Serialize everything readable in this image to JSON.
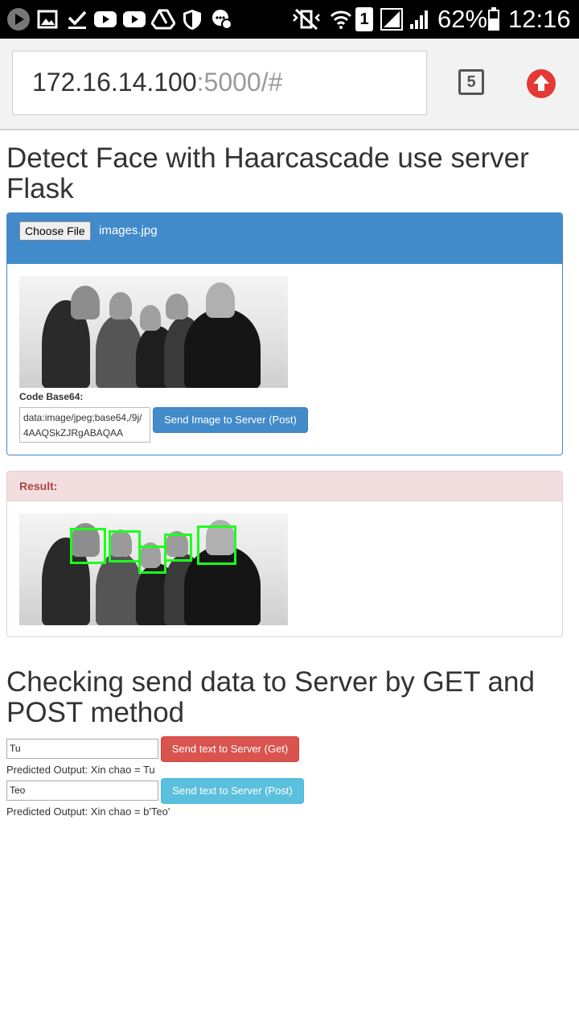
{
  "statusbar": {
    "battery": "62%",
    "time": "12:16",
    "sim_slot": "1"
  },
  "browser": {
    "url_host": "172.16.14.100",
    "url_rest": ":5000/#",
    "tab_count": "5",
    "accent_color": "#e53935"
  },
  "page": {
    "title": "Detect Face with Haarcascade use server Flask",
    "upload_panel": {
      "choose_file_label": "Choose File",
      "file_name": "images.jpg",
      "code_label": "Code Base64:",
      "base64_value": "data:image/jpeg;base64,/9j/4AAQSkZJRgABAQAA",
      "send_image_button": "Send Image to Server (Post)"
    },
    "result_panel": {
      "label": "Result:"
    },
    "section2_title": "Checking send data to Server by GET and POST method",
    "get_form": {
      "input_value": "Tu",
      "button_label": "Send text to Server (Get)",
      "output": "Predicted Output: Xin chao = Tu"
    },
    "post_form": {
      "input_value": "Teo",
      "button_label": "Send text to Server (Post)",
      "output": "Predicted Output: Xin chao = b'Teo'"
    }
  },
  "colors": {
    "primary": "#428bca",
    "danger": "#d9534f",
    "info": "#5bc0de",
    "detect_box": "#1dff1d"
  }
}
